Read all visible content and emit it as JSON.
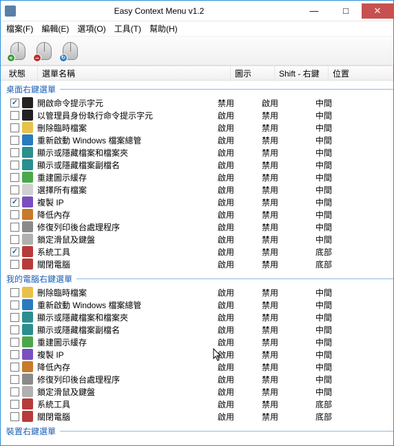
{
  "window": {
    "title": "Easy Context Menu v1.2"
  },
  "menus": {
    "file": "檔案(F)",
    "edit": "編輯(E)",
    "options": "選項(O)",
    "tools": "工具(T)",
    "help": "幫助(H)"
  },
  "columns": {
    "status": "狀態",
    "name": "選單名稱",
    "icon": "圖示",
    "shift": "Shift - 右鍵",
    "position": "位置"
  },
  "section1": {
    "title": "桌面右鍵選單",
    "rows": [
      {
        "checked": true,
        "ic": "#222",
        "name": "開啟命令提示字元",
        "c1": "禁用",
        "c2": "啟用",
        "c3": "中間"
      },
      {
        "checked": false,
        "ic": "#222",
        "name": "以管理員身份執行命令提示字元",
        "c1": "啟用",
        "c2": "禁用",
        "c3": "中間"
      },
      {
        "checked": false,
        "ic": "#e7c14a",
        "name": "刪除臨時檔案",
        "c1": "啟用",
        "c2": "禁用",
        "c3": "中間"
      },
      {
        "checked": false,
        "ic": "#2a7abf",
        "name": "重新啟動 Windows 檔案總管",
        "c1": "啟用",
        "c2": "禁用",
        "c3": "中間"
      },
      {
        "checked": false,
        "ic": "#2a8f8f",
        "name": "顯示或隱藏檔案和檔案夾",
        "c1": "啟用",
        "c2": "禁用",
        "c3": "中間"
      },
      {
        "checked": false,
        "ic": "#2a8f8f",
        "name": "顯示或隱藏檔案副檔名",
        "c1": "啟用",
        "c2": "禁用",
        "c3": "中間"
      },
      {
        "checked": false,
        "ic": "#4aa84a",
        "name": "重建圖示緩存",
        "c1": "啟用",
        "c2": "禁用",
        "c3": "中間"
      },
      {
        "checked": false,
        "ic": "#d0d0d0",
        "name": "選擇所有檔案",
        "c1": "啟用",
        "c2": "禁用",
        "c3": "中間"
      },
      {
        "checked": true,
        "ic": "#7a4fbf",
        "name": "複製 IP",
        "c1": "啟用",
        "c2": "禁用",
        "c3": "中間"
      },
      {
        "checked": false,
        "ic": "#c77a2a",
        "name": "降低內存",
        "c1": "啟用",
        "c2": "禁用",
        "c3": "中間"
      },
      {
        "checked": false,
        "ic": "#8a8a8a",
        "name": "修復列印後台處理程序",
        "c1": "啟用",
        "c2": "禁用",
        "c3": "中間"
      },
      {
        "checked": false,
        "ic": "#b0b0b0",
        "name": "鎖定滑鼠及鍵盤",
        "c1": "啟用",
        "c2": "禁用",
        "c3": "中間"
      },
      {
        "checked": true,
        "ic": "#b83a3a",
        "name": "系統工具",
        "c1": "啟用",
        "c2": "禁用",
        "c3": "底部"
      },
      {
        "checked": false,
        "ic": "#b83a3a",
        "name": "關閉電腦",
        "c1": "啟用",
        "c2": "禁用",
        "c3": "底部"
      }
    ]
  },
  "section2": {
    "title": "我的電腦右鍵選單",
    "rows": [
      {
        "checked": false,
        "ic": "#e7c14a",
        "name": "刪除臨時檔案",
        "c1": "啟用",
        "c2": "禁用",
        "c3": "中間"
      },
      {
        "checked": false,
        "ic": "#2a7abf",
        "name": "重新啟動 Windows 檔案總管",
        "c1": "啟用",
        "c2": "禁用",
        "c3": "中間"
      },
      {
        "checked": false,
        "ic": "#2a8f8f",
        "name": "顯示或隱藏檔案和檔案夾",
        "c1": "啟用",
        "c2": "禁用",
        "c3": "中間"
      },
      {
        "checked": false,
        "ic": "#2a8f8f",
        "name": "顯示或隱藏檔案副檔名",
        "c1": "啟用",
        "c2": "禁用",
        "c3": "中間"
      },
      {
        "checked": false,
        "ic": "#4aa84a",
        "name": "重建圖示緩存",
        "c1": "啟用",
        "c2": "禁用",
        "c3": "中間"
      },
      {
        "checked": false,
        "ic": "#7a4fbf",
        "name": "複製 IP",
        "c1": "啟用",
        "c2": "禁用",
        "c3": "中間"
      },
      {
        "checked": false,
        "ic": "#c77a2a",
        "name": "降低內存",
        "c1": "啟用",
        "c2": "禁用",
        "c3": "中間"
      },
      {
        "checked": false,
        "ic": "#8a8a8a",
        "name": "修復列印後台處理程序",
        "c1": "啟用",
        "c2": "禁用",
        "c3": "中間"
      },
      {
        "checked": false,
        "ic": "#b0b0b0",
        "name": "鎖定滑鼠及鍵盤",
        "c1": "啟用",
        "c2": "禁用",
        "c3": "中間"
      },
      {
        "checked": false,
        "ic": "#b83a3a",
        "name": "系統工具",
        "c1": "啟用",
        "c2": "禁用",
        "c3": "底部"
      },
      {
        "checked": false,
        "ic": "#b83a3a",
        "name": "關閉電腦",
        "c1": "啟用",
        "c2": "禁用",
        "c3": "底部"
      }
    ]
  },
  "section3": {
    "title": "裝置右鍵選單"
  }
}
